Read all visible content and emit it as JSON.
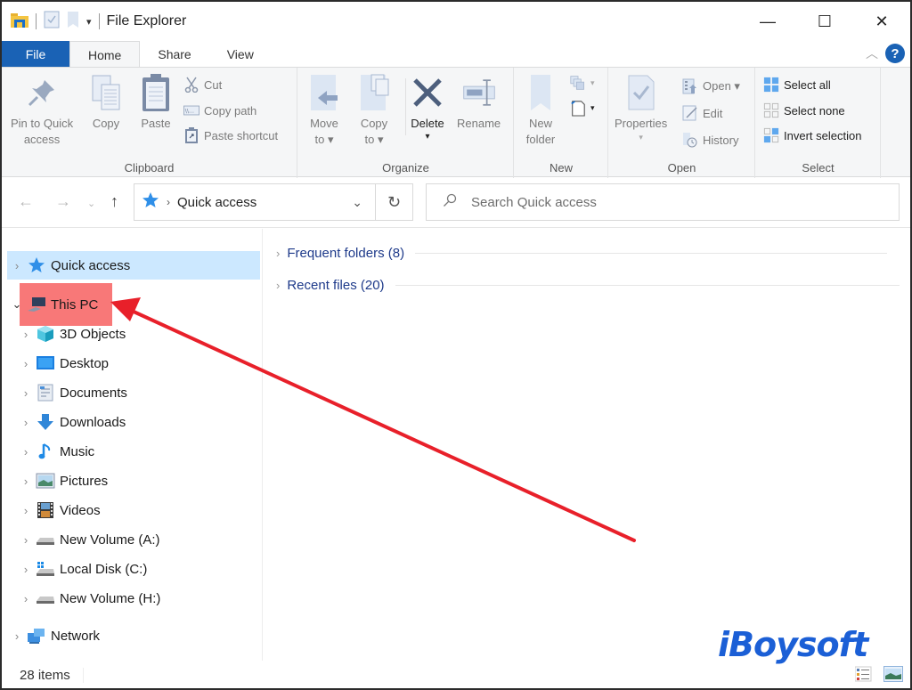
{
  "window": {
    "title": "File Explorer",
    "controls": {
      "minimize": "—",
      "maximize": "☐",
      "close": "✕"
    }
  },
  "ribbon_tabs": [
    {
      "label": "File",
      "state": "file"
    },
    {
      "label": "Home",
      "state": "active"
    },
    {
      "label": "Share",
      "state": "normal"
    },
    {
      "label": "View",
      "state": "normal"
    }
  ],
  "ribbon": {
    "clipboard": {
      "group_label": "Clipboard",
      "pin_label_1": "Pin to Quick",
      "pin_label_2": "access",
      "copy": "Copy",
      "paste": "Paste",
      "cut": "Cut",
      "copy_path": "Copy path",
      "paste_shortcut": "Paste shortcut"
    },
    "organize": {
      "group_label": "Organize",
      "move_to_1": "Move",
      "move_to_2": "to ▾",
      "copy_to_1": "Copy",
      "copy_to_2": "to ▾",
      "delete": "Delete",
      "delete_arrow": "▾",
      "rename": "Rename"
    },
    "new": {
      "group_label": "New",
      "new_folder_1": "New",
      "new_folder_2": "folder"
    },
    "open": {
      "group_label": "Open",
      "properties": "Properties",
      "properties_arrow": "▾",
      "open": "Open ▾",
      "edit": "Edit",
      "history": "History"
    },
    "select": {
      "group_label": "Select",
      "select_all": "Select all",
      "select_none": "Select none",
      "invert_selection": "Invert selection"
    }
  },
  "address_bar": {
    "path": "Quick access",
    "search_placeholder": "Search Quick access"
  },
  "nav_pane": {
    "quick_access": "Quick access",
    "this_pc": "This PC",
    "children": [
      "3D Objects",
      "Desktop",
      "Documents",
      "Downloads",
      "Music",
      "Pictures",
      "Videos",
      "New Volume (A:)",
      "Local Disk (C:)",
      "New Volume (H:)"
    ],
    "network": "Network"
  },
  "content": {
    "sections": [
      {
        "label": "Frequent folders (8)"
      },
      {
        "label": "Recent files (20)"
      }
    ]
  },
  "status_bar": {
    "item_count": "28 items"
  },
  "annotation": {
    "highlight_color": "#f87171",
    "arrow_color": "#e8202a"
  },
  "watermark": "iBoysoft",
  "colors": {
    "accent": "#1a62b5",
    "selection": "#cce8ff",
    "section_text": "#1e3a8a"
  }
}
